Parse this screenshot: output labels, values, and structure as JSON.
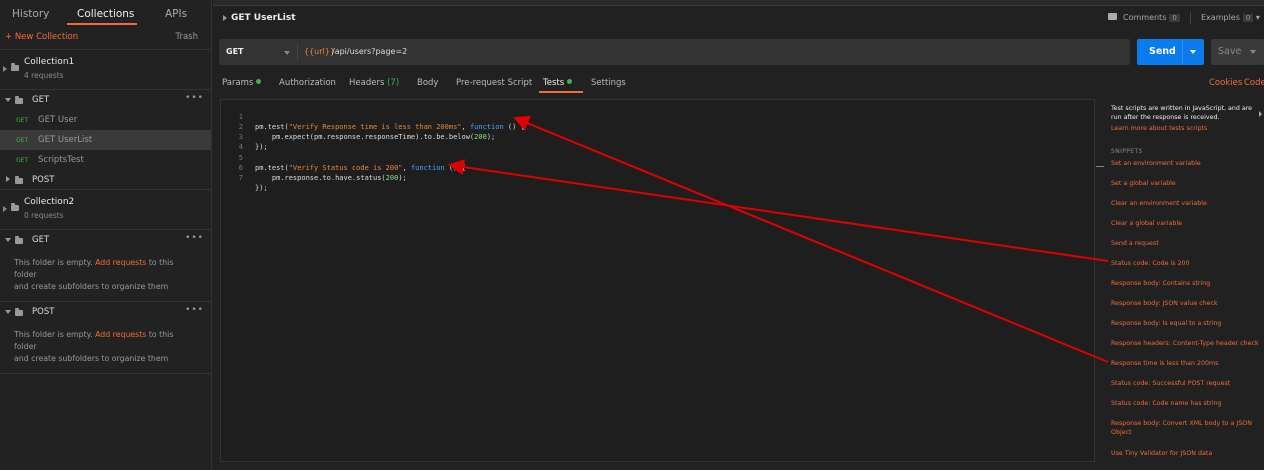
{
  "sidebar": {
    "tabs": [
      "History",
      "Collections",
      "APIs"
    ],
    "new_collection": "+ New Collection",
    "trash": "Trash",
    "collection1": {
      "name": "Collection1",
      "count": "4 requests",
      "folders": {
        "get": "GET",
        "post": "POST"
      },
      "requests": [
        {
          "method": "GET",
          "name": "GET User"
        },
        {
          "method": "GET",
          "name": "GET UserList"
        },
        {
          "method": "GET",
          "name": "ScriptsTest"
        }
      ]
    },
    "collection2": {
      "name": "Collection2",
      "count": "0 requests",
      "folders": {
        "get": "GET",
        "post": "POST"
      }
    },
    "empty": {
      "line1_prefix": "This folder is empty.",
      "link": "Add requests",
      "line1_suffix": "to this folder",
      "line2": "and create subfolders to organize them"
    },
    "more": "•••"
  },
  "header": {
    "title": "GET UserList",
    "comments_label": "Comments",
    "comments_count": "0",
    "examples_label": "Examples",
    "examples_count": "0"
  },
  "request": {
    "method": "GET",
    "url_var": "{{url}}",
    "url_path": "/api/users?page=2",
    "send": "Send",
    "save": "Save"
  },
  "tabs": {
    "params": "Params",
    "authorization": "Authorization",
    "headers": "Headers",
    "headers_count": "(7)",
    "body": "Body",
    "prerequest": "Pre-request Script",
    "tests": "Tests",
    "settings": "Settings",
    "cookies": "Cookies",
    "code": "Code"
  },
  "editor": {
    "line_numbers": [
      "1",
      "2",
      "3",
      "4",
      "5",
      "6",
      "7"
    ],
    "l1_a": "pm.test(",
    "l1_str": "\"Verify Response time is less than 200ms\"",
    "l1_b": ", ",
    "l1_kw": "function",
    "l1_c": " () {",
    "l2_a": "    pm.expect(pm.response.responseTime).to.be.below(",
    "l2_num": "200",
    "l2_b": ");",
    "l3": "});",
    "l5_a": "pm.test(",
    "l5_str": "\"Verify Status code is 200\"",
    "l5_b": ", ",
    "l5_kw": "function",
    "l5_c": " () {",
    "l6_a": "    pm.response.to.have.status(",
    "l6_num": "200",
    "l6_b": ");",
    "l7": "});"
  },
  "snippets_panel": {
    "info": "Test scripts are written in JavaScript, and are run after the response is received.",
    "learn_more": "Learn more about tests scripts",
    "header": "SNIPPETS",
    "items": [
      "Set an environment variable",
      "Set a global variable",
      "Clear an environment variable",
      "Clear a global variable",
      "Send a request",
      "Status code: Code is 200",
      "Response body: Contains string",
      "Response body: JSON value check",
      "Response body: Is equal to a string",
      "Response headers: Content-Type header check",
      "Response time is less than 200ms",
      "Status code: Successful POST request",
      "Status code: Code name has string",
      "Response body: Convert XML body to a JSON Object",
      "Use Tiny Validator for JSON data"
    ]
  },
  "colors": {
    "accent": "#f26b3a",
    "send": "#097bed",
    "success": "#39b54a",
    "annotation_arrow": "#e00000"
  }
}
